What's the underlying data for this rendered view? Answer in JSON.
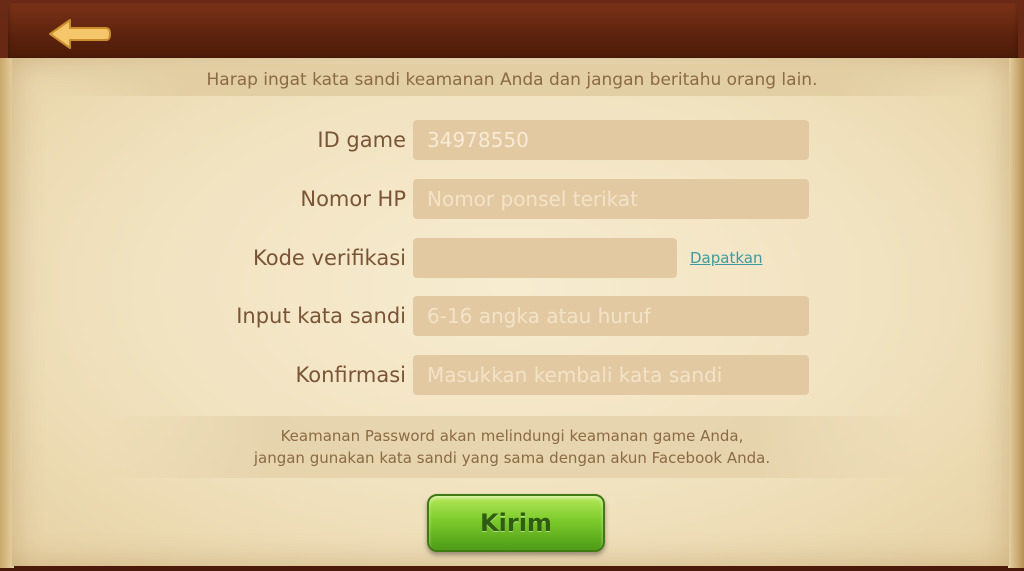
{
  "header": {
    "back_icon": "arrow-left-icon"
  },
  "notice": "Harap ingat kata sandi keamanan Anda dan jangan beritahu orang lain.",
  "form": {
    "game_id": {
      "label": "ID game",
      "value": "34978550"
    },
    "phone": {
      "label": "Nomor HP",
      "placeholder": "Nomor ponsel terikat"
    },
    "verification": {
      "label": "Kode verifikasi",
      "value": "",
      "link": "Dapatkan"
    },
    "password": {
      "label": "Input kata sandi",
      "placeholder": "6-16 angka atau huruf"
    },
    "confirm": {
      "label": "Konfirmasi",
      "placeholder": "Masukkan kembali kata sandi"
    }
  },
  "info": {
    "line1": "Keamanan Password akan melindungi keamanan game Anda,",
    "line2": "jangan gunakan kata sandi yang sama dengan akun Facebook Anda."
  },
  "submit_label": "Kirim",
  "colors": {
    "accent_link": "#3d9aa0",
    "button_green": "#7ccb2a",
    "frame_brown": "#5b220d",
    "paper": "#f1e2bf"
  }
}
